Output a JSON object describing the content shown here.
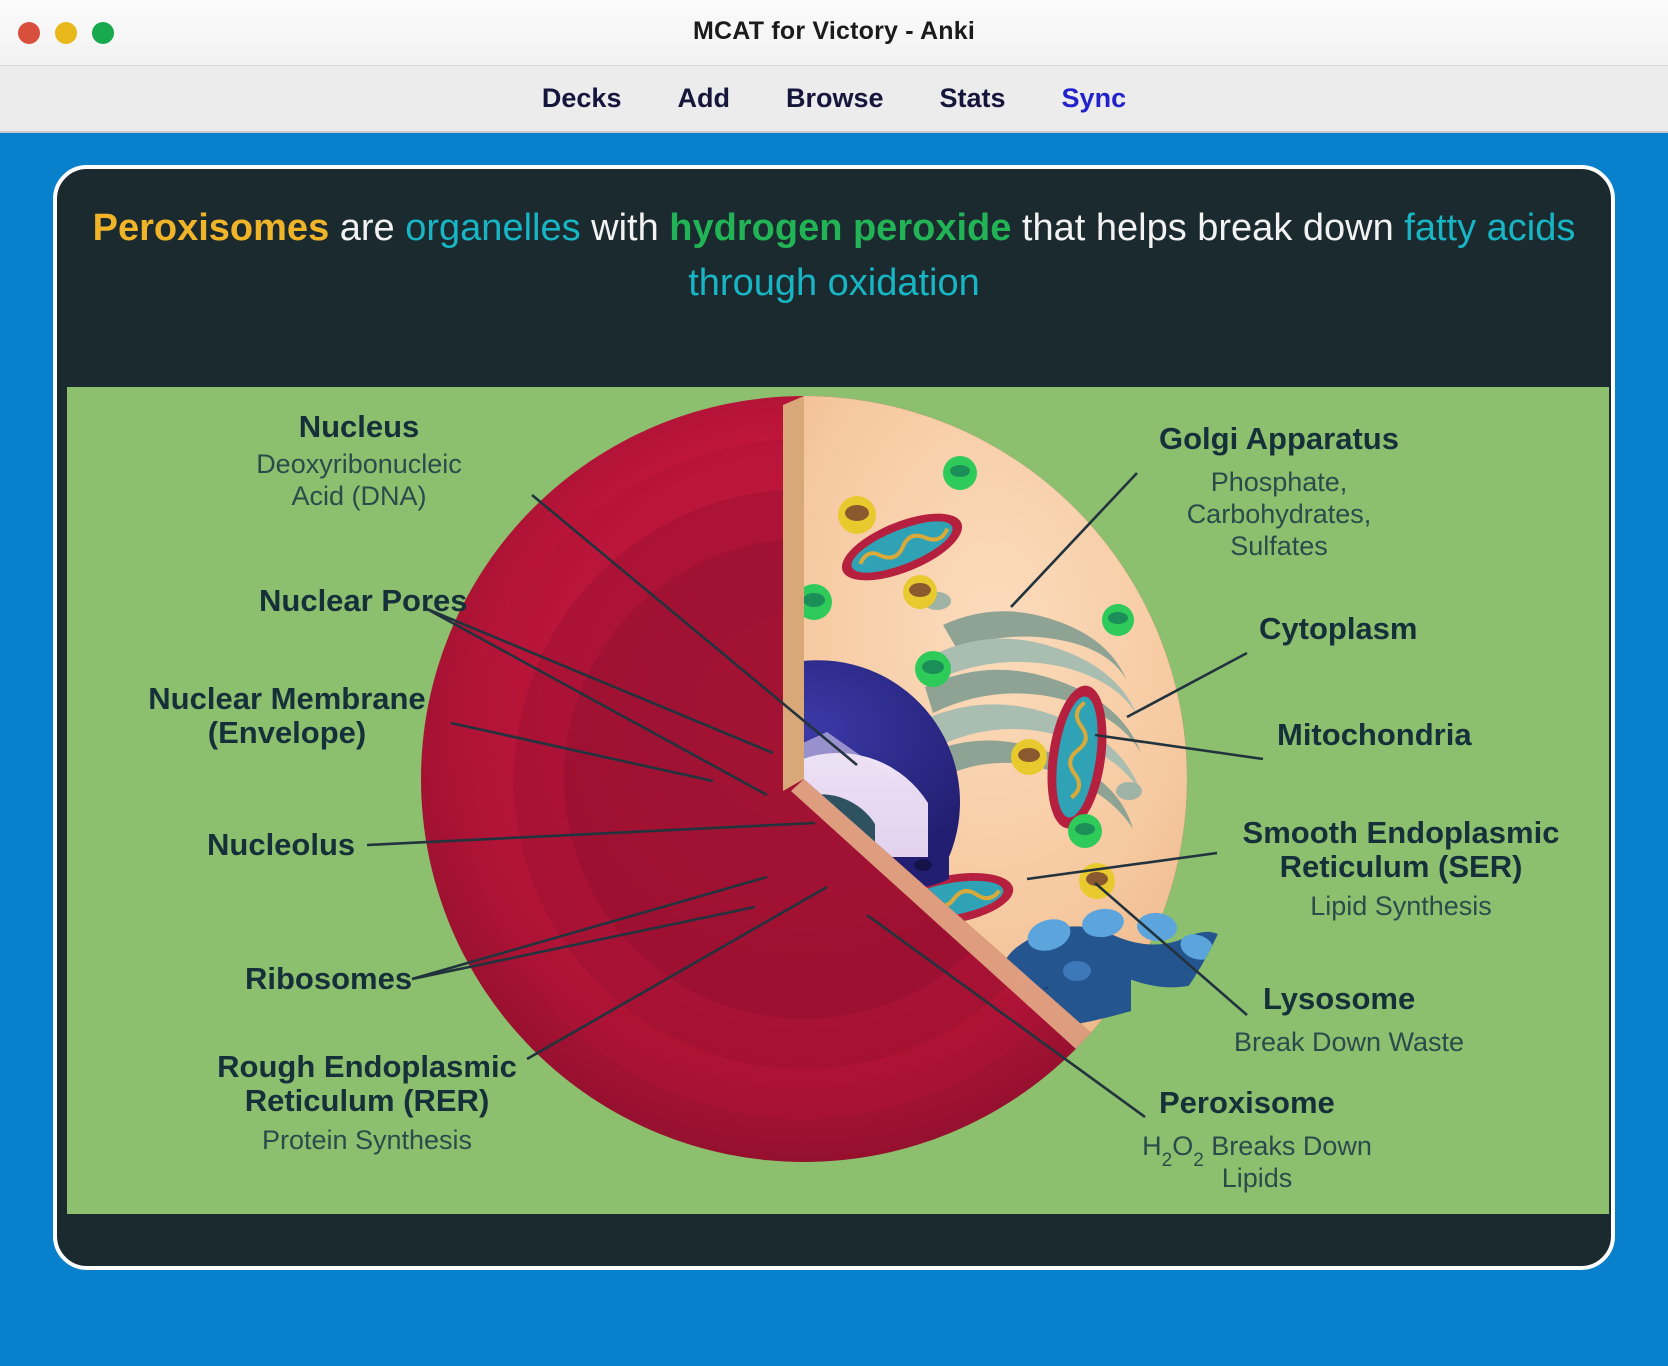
{
  "window": {
    "title": "MCAT for Victory - Anki",
    "controls": [
      {
        "name": "close",
        "color": "#d94f3d"
      },
      {
        "name": "minimize",
        "color": "#e8b81b"
      },
      {
        "name": "zoom",
        "color": "#18a84e"
      }
    ]
  },
  "toolbar": {
    "items": [
      {
        "label": "Decks",
        "active": false
      },
      {
        "label": "Add",
        "active": false
      },
      {
        "label": "Browse",
        "active": false
      },
      {
        "label": "Stats",
        "active": false
      },
      {
        "label": "Sync",
        "active": true
      }
    ],
    "sync_color": "#2323cc"
  },
  "card": {
    "background": "#1b2a2f",
    "border_color": "#ffffff",
    "question": {
      "segments": [
        {
          "text": "Peroxisomes",
          "style": "gold"
        },
        {
          "text": " are ",
          "style": "white"
        },
        {
          "text": "organelles",
          "style": "cyan"
        },
        {
          "text": " with ",
          "style": "white"
        },
        {
          "text": "hydrogen peroxide",
          "style": "green"
        },
        {
          "text": " that helps break down ",
          "style": "white"
        },
        {
          "text": "fatty acids through oxidation",
          "style": "cyan"
        }
      ],
      "colors": {
        "gold": "#f0b429",
        "cyan": "#18b5c4",
        "green": "#22b356",
        "white": "#f2f2f2"
      }
    }
  },
  "diagram": {
    "background": "#8cc06f",
    "caption": "Animal cell cutaway cross-section with labeled organelles",
    "labels_left": [
      {
        "title": "Nucleus",
        "sub": "Deoxyribonucleic\nAcid (DNA)"
      },
      {
        "title": "Nuclear Pores",
        "sub": ""
      },
      {
        "title": "Nuclear Membrane\n(Envelope)",
        "sub": ""
      },
      {
        "title": "Nucleolus",
        "sub": ""
      },
      {
        "title": "Ribosomes",
        "sub": ""
      },
      {
        "title": "Rough Endoplasmic\nReticulum (RER)",
        "sub": "Protein Synthesis"
      }
    ],
    "labels_right": [
      {
        "title": "Golgi Apparatus",
        "sub": "Phosphate,\nCarbohydrates,\nSulfates"
      },
      {
        "title": "Cytoplasm",
        "sub": ""
      },
      {
        "title": "Mitochondria",
        "sub": ""
      },
      {
        "title": "Smooth Endoplasmic\nReticulum (SER)",
        "sub": "Lipid Synthesis"
      },
      {
        "title": "Lysosome",
        "sub": "Break Down Waste"
      },
      {
        "title": "Peroxisome",
        "sub": "H2O2 Breaks Down\nLipids"
      }
    ],
    "label_text": {
      "nucleus": "Nucleus",
      "nucleus_sub1": "Deoxyribonucleic",
      "nucleus_sub2": "Acid (DNA)",
      "nuclear_pores": "Nuclear Pores",
      "nuclear_membrane1": "Nuclear Membrane",
      "nuclear_membrane2": "(Envelope)",
      "nucleolus": "Nucleolus",
      "ribosomes": "Ribosomes",
      "rer1": "Rough Endoplasmic",
      "rer2": "Reticulum (RER)",
      "rer_sub": "Protein Synthesis",
      "golgi": "Golgi Apparatus",
      "golgi_sub1": "Phosphate,",
      "golgi_sub2": "Carbohydrates,",
      "golgi_sub3": "Sulfates",
      "cytoplasm": "Cytoplasm",
      "mitochondria": "Mitochondria",
      "ser1": "Smooth Endoplasmic",
      "ser2": "Reticulum (SER)",
      "ser_sub": "Lipid Synthesis",
      "lysosome": "Lysosome",
      "lysosome_sub": "Break Down Waste",
      "peroxisome": "Peroxisome",
      "peroxisome_sub_a": "H",
      "peroxisome_sub_b": "2",
      "peroxisome_sub_c": "O",
      "peroxisome_sub_d": "2",
      "peroxisome_sub_e": " Breaks Down",
      "peroxisome_sub2": "Lipids"
    },
    "colors": {
      "membrane_outer": "#c4163c",
      "membrane_dark": "#8d0f2c",
      "cytoplasm": "#f6c9a0",
      "nucleus_envelope": "#2b2a86",
      "nucleoplasm": "#e4d4ee",
      "nucleolus": "#2e5260",
      "rer": "#2f6fb5",
      "ser": "#2c5fa8",
      "golgi": "#93a99c",
      "lysosome": "#e8c92e",
      "peroxisome": "#2ecb5a",
      "mito_outer": "#b5203f",
      "mito_inner": "#2fa3b5"
    }
  }
}
